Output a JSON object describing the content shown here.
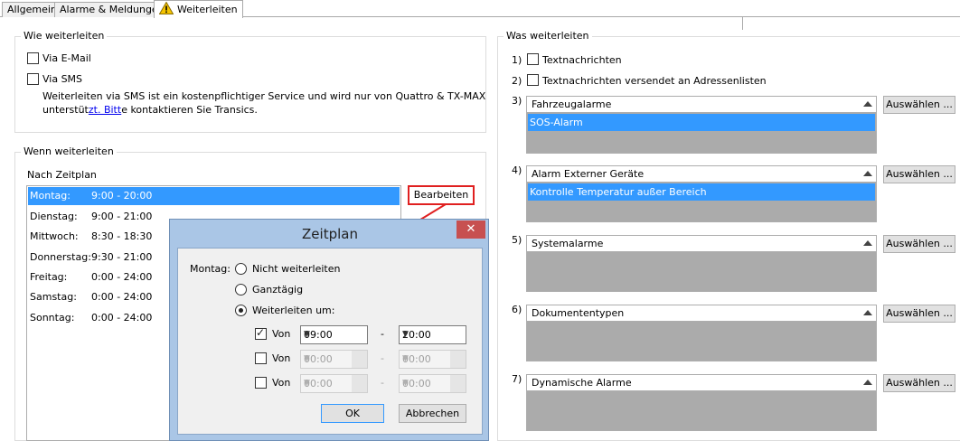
{
  "tabs": [
    "Allgemein",
    "Alarme & Meldungen",
    "Weiterleiten"
  ],
  "how": {
    "title": "Wie weiterleiten",
    "email": "Via E-Mail",
    "sms": "Via SMS",
    "info_line1": "Weiterleiten via SMS ist ein kostenpflichtiger Service und wird nur von Quattro & TX-MAX",
    "info_line2_a": "unterstüt",
    "info_line2_link": "zt. Bitt",
    "info_line2_b": "e kontaktieren Sie Transics."
  },
  "when": {
    "title": "Wenn weiterleiten",
    "subtitle": "Nach Zeitplan",
    "edit_button": "Bearbeiten",
    "schedule": [
      {
        "day": "Montag:",
        "time": "9:00 - 20:00"
      },
      {
        "day": "Dienstag:",
        "time": "9:00 - 21:00"
      },
      {
        "day": "Mittwoch:",
        "time": "8:30 - 18:30"
      },
      {
        "day": "Donnerstag:",
        "time": "9:30 - 21:00"
      },
      {
        "day": "Freitag:",
        "time": "0:00 - 24:00"
      },
      {
        "day": "Samstag:",
        "time": "0:00 - 24:00"
      },
      {
        "day": "Sonntag:",
        "time": "0:00 - 24:00"
      }
    ]
  },
  "what": {
    "title": "Was weiterleiten",
    "items": [
      {
        "num": "1)",
        "label": "Textnachrichten"
      },
      {
        "num": "2)",
        "label": "Textnachrichten versendet an Adressenlisten"
      }
    ],
    "lists": [
      {
        "num": "3)",
        "header": "Fahrzeugalarme",
        "selected": "SOS-Alarm",
        "button": "Auswählen ..."
      },
      {
        "num": "4)",
        "header": "Alarm Externer Geräte",
        "selected": "Kontrolle Temperatur außer Bereich",
        "button": "Auswählen ..."
      },
      {
        "num": "5)",
        "header": "Systemalarme",
        "selected": "",
        "button": "Auswählen ..."
      },
      {
        "num": "6)",
        "header": "Dokumententypen",
        "selected": "",
        "button": "Auswählen ..."
      },
      {
        "num": "7)",
        "header": "Dynamische Alarme",
        "selected": "",
        "button": "Auswählen ..."
      }
    ]
  },
  "dialog": {
    "title": "Zeitplan",
    "close": "✕",
    "day_label": "Montag:",
    "options": [
      "Nicht weiterleiten",
      "Ganztägig",
      "Weiterleiten um:"
    ],
    "von": "Von",
    "dash": "-",
    "rows": [
      {
        "from": "09:00",
        "to": "20:00"
      },
      {
        "from": "00:00",
        "to": "00:00"
      },
      {
        "from": "00:00",
        "to": "00:00"
      }
    ],
    "ok": "OK",
    "cancel": "Abbrechen"
  },
  "colors": {
    "selection": "#3399ff",
    "callout": "#e02020",
    "dialog_frame": "#aac6e6"
  }
}
